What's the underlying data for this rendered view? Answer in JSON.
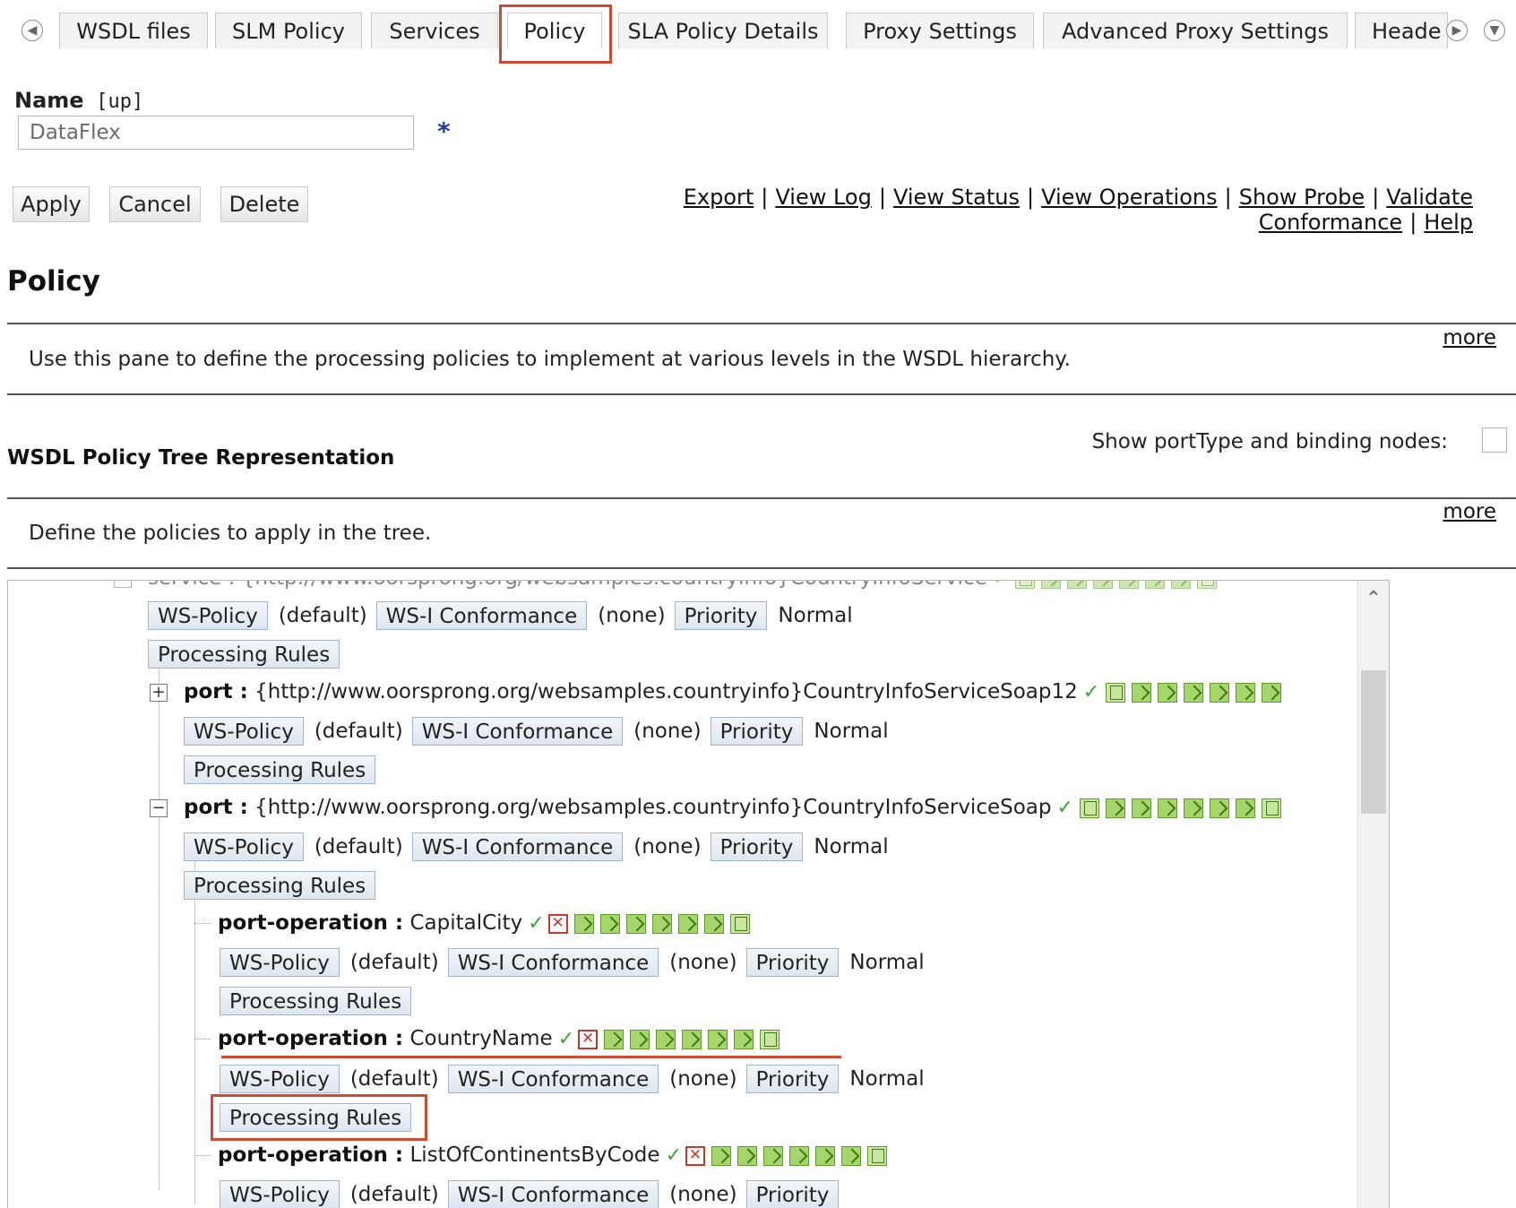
{
  "tabs": {
    "items": [
      {
        "label": "WSDL files"
      },
      {
        "label": "SLM Policy"
      },
      {
        "label": "Services"
      },
      {
        "label": "Policy"
      },
      {
        "label": "SLA Policy Details"
      },
      {
        "label": "Proxy Settings"
      },
      {
        "label": "Advanced Proxy Settings"
      },
      {
        "label": "Heade"
      }
    ],
    "active": "Policy",
    "prev_icon": "arrow-left-circle-icon",
    "next_icon": "arrow-right-circle-icon",
    "menu_icon": "chevron-down-circle-icon"
  },
  "form": {
    "name_label": "Name",
    "name_hint": "[up]",
    "name_value": "DataFlex",
    "required_mark": "*"
  },
  "buttons": {
    "apply": "Apply",
    "cancel": "Cancel",
    "delete": "Delete"
  },
  "links": {
    "export": "Export",
    "view_log": "View Log",
    "view_status": "View Status",
    "view_operations": "View Operations",
    "show_probe": "Show Probe",
    "validate_conformance": "Validate Conformance",
    "help": "Help",
    "separator": "|"
  },
  "policy_section": {
    "heading": "Policy",
    "description": "Use this pane to define the processing policies to implement at various levels in the WSDL hierarchy.",
    "more": "more"
  },
  "tree_section": {
    "heading": "WSDL Policy Tree Representation",
    "show_nodes_label": "Show portType and binding nodes:",
    "description": "Define the policies to apply in the tree.",
    "more": "more"
  },
  "tree": {
    "ws_policy_label": "WS-Policy",
    "ws_policy_value": "(default)",
    "wsi_label": "WS-I Conformance",
    "wsi_value": "(none)",
    "priority_label": "Priority",
    "priority_value": "Normal",
    "processing_rules_label": "Processing Rules",
    "service_partial": "service : {http://www.oorsprong.org/websamples.countryinfo}CountryInfoService",
    "nodes": [
      {
        "key": "port :",
        "value": "{http://www.oorsprong.org/websamples.countryinfo}CountryInfoServiceSoap12",
        "expander": "+"
      },
      {
        "key": "port :",
        "value": "{http://www.oorsprong.org/websamples.countryinfo}CountryInfoServiceSoap",
        "expander": "−"
      },
      {
        "key": "port-operation :",
        "value": "CapitalCity"
      },
      {
        "key": "port-operation :",
        "value": "CountryName"
      },
      {
        "key": "port-operation :",
        "value": "ListOfContinentsByCode"
      }
    ],
    "check_icon": "checkmark-icon",
    "disabled_icon": "red-x-icon",
    "rule_icon": "green-rule-icon"
  },
  "colors": {
    "annotation": "#d04a32",
    "button_border": "#9fb7cd",
    "required_star": "#2a3a9a"
  }
}
